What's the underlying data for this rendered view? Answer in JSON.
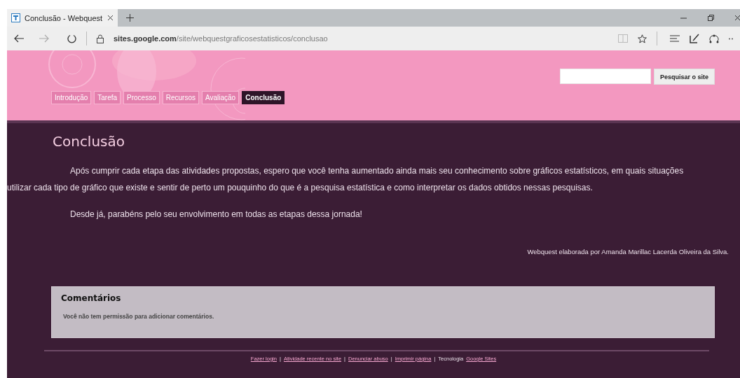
{
  "browser": {
    "tab_title": "Conclusão - Webquest",
    "address": "**sites.google.com**/site/webquestgraficosestatisticos/conclusao"
  },
  "header": {
    "nav": [
      {
        "label": "Introdução",
        "selected": false
      },
      {
        "label": "Tarefa",
        "selected": false
      },
      {
        "label": "Processo",
        "selected": false
      },
      {
        "label": "Recursos",
        "selected": false
      },
      {
        "label": "Avaliação",
        "selected": false
      },
      {
        "label": "Conclusão",
        "selected": true
      }
    ],
    "search": {
      "button": "Pesquisar o site"
    }
  },
  "page": {
    "title": "Conclusão",
    "blocks": [
      {
        "kind": "paragraph",
        "text": "Após cumprir cada etapa das atividades propostas, espero que você tenha aumentado ainda mais seu conhecimento sobre gráficos estatísticos, em quais situações utilizar cada tipo de gráfico que existe e sentir de perto um pouquinho do que é a pesquisa estatística e como interpretar os dados obtidos nessas pesquisas."
      },
      {
        "kind": "paragraph",
        "text": "Desde já, parabéns pelo seu envolvimento em todas as etapas dessa jornada!"
      },
      {
        "kind": "signature",
        "text": "Webquest elaborada por Amanda Marillac Lacerda Oliveira da Silva."
      }
    ]
  },
  "comments": {
    "title": "Comentários",
    "message": "Você não tem permissão para adicionar comentários."
  },
  "footer": [
    {
      "kind": "link",
      "text": "Fazer login"
    },
    {
      "kind": "separator",
      "text": "|"
    },
    {
      "kind": "link",
      "text": "Atividade recente no site"
    },
    {
      "kind": "separator",
      "text": "|"
    },
    {
      "kind": "link",
      "text": "Denunciar abuso"
    },
    {
      "kind": "separator",
      "text": "|"
    },
    {
      "kind": "link",
      "text": "Imprimir página"
    },
    {
      "kind": "separator",
      "text": "|"
    },
    {
      "kind": "text",
      "text": "Tecnologia"
    },
    {
      "kind": "link",
      "text": "Google Sites"
    }
  ]
}
